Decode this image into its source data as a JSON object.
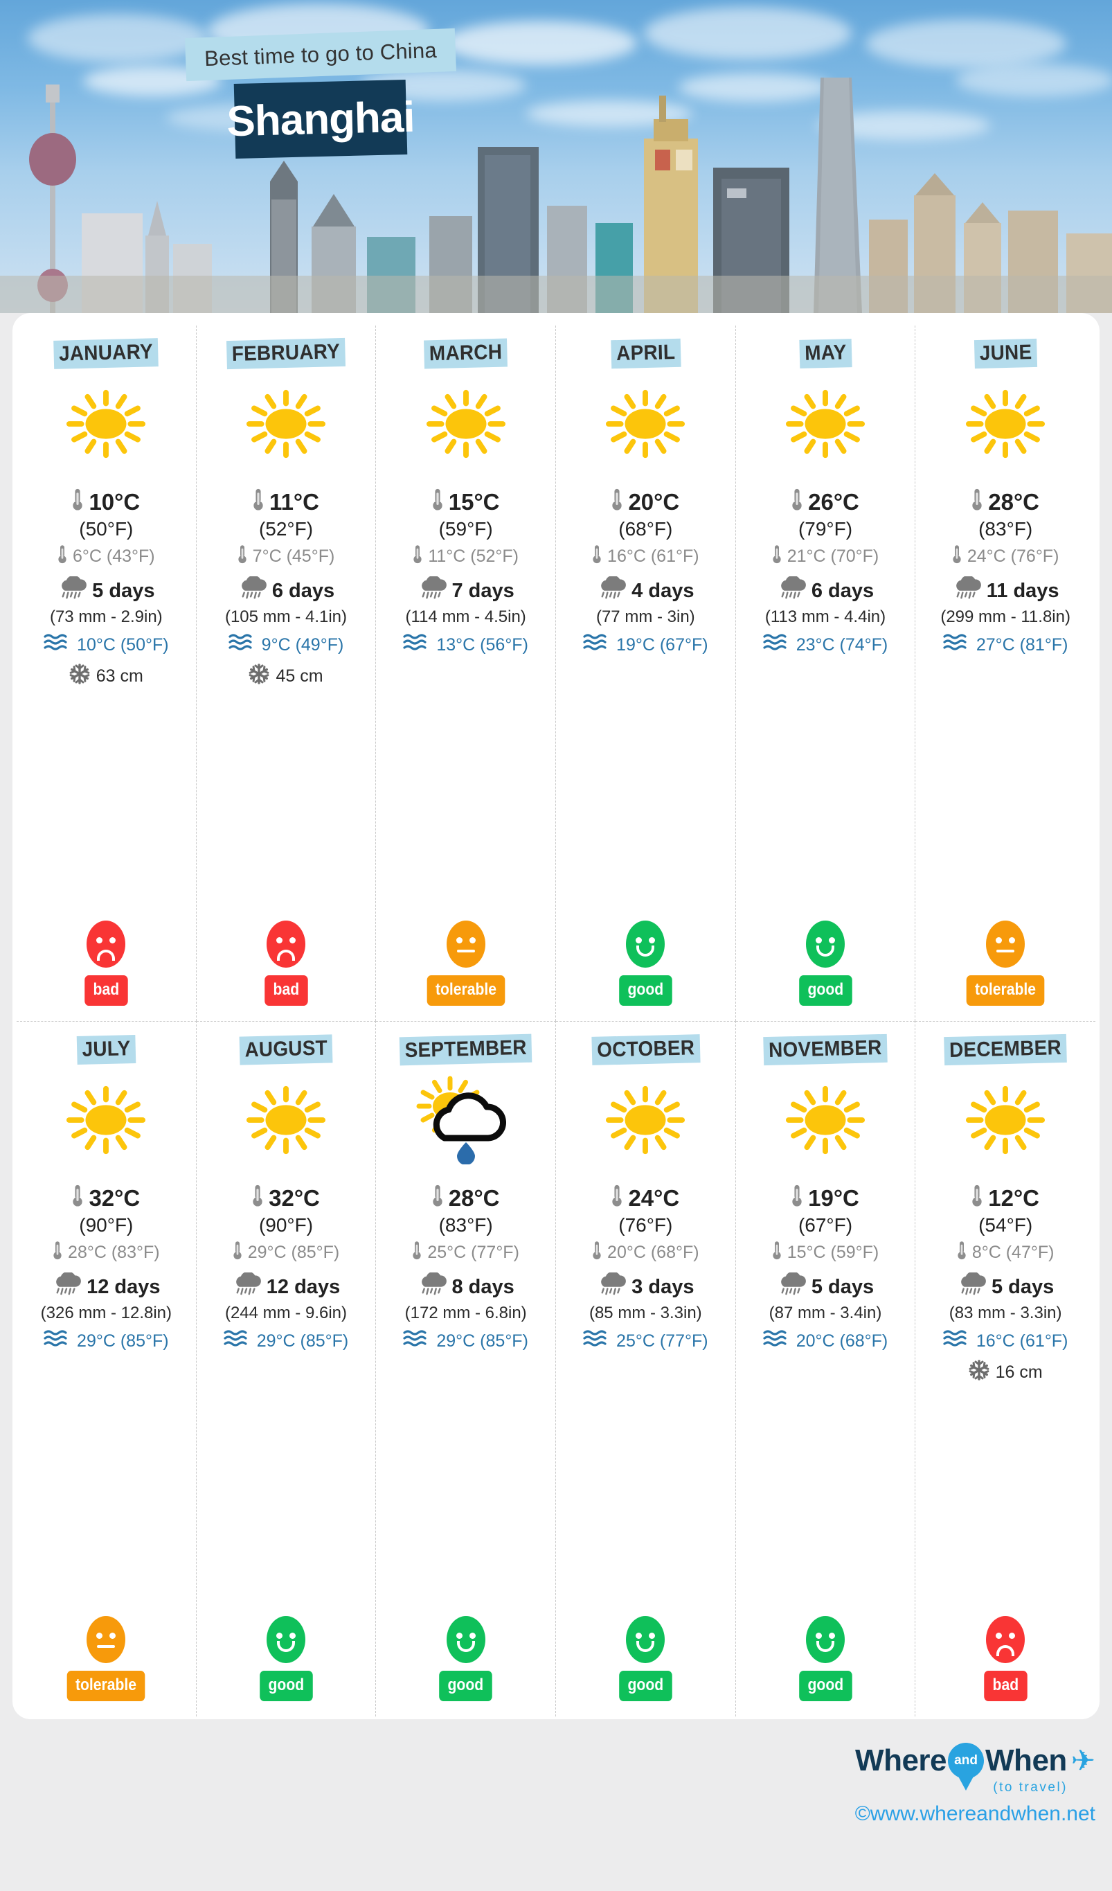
{
  "hero": {
    "subtitle": "Best time to go to China",
    "city": "Shanghai",
    "banner_color": "#b4dcec",
    "city_banner_color": "#123a56"
  },
  "footer": {
    "logo_word1": "Where",
    "logo_pin": "and",
    "logo_word2": "When",
    "logo_tagline": "(to travel)",
    "website": "©www.whereandwhen.net",
    "plane_icon": "airplane-icon",
    "accent_color": "#29a3e0",
    "dark_color": "#123a56"
  },
  "legend": {
    "icons": {
      "thermometer": "thermometer-icon",
      "rain_cloud": "rain-cloud-icon",
      "waves": "sea-temperature-icon",
      "snowflake": "snowflake-icon",
      "sun": "sun-icon",
      "sun_cloud_rain": "sun-cloud-rain-icon"
    },
    "verdict_colors": {
      "good": "#0fc05a",
      "tolerable": "#f79a0b",
      "bad": "#f93535"
    }
  },
  "months": [
    {
      "name": "JANUARY",
      "sky": "sun",
      "temp_max_c": "10°C",
      "temp_max_f": "(50°F)",
      "temp_min": "6°C (43°F)",
      "rain_days": "5 days",
      "rain_amount": "(73 mm - 2.9in)",
      "sea_temp": "10°C (50°F)",
      "snow": "63 cm",
      "verdict": "bad",
      "face": "frown"
    },
    {
      "name": "FEBRUARY",
      "sky": "sun",
      "temp_max_c": "11°C",
      "temp_max_f": "(52°F)",
      "temp_min": "7°C (45°F)",
      "rain_days": "6 days",
      "rain_amount": "(105 mm - 4.1in)",
      "sea_temp": "9°C (49°F)",
      "snow": "45 cm",
      "verdict": "bad",
      "face": "frown"
    },
    {
      "name": "MARCH",
      "sky": "sun",
      "temp_max_c": "15°C",
      "temp_max_f": "(59°F)",
      "temp_min": "11°C (52°F)",
      "rain_days": "7 days",
      "rain_amount": "(114 mm - 4.5in)",
      "sea_temp": "13°C (56°F)",
      "snow": "",
      "verdict": "tolerable",
      "face": "flat"
    },
    {
      "name": "APRIL",
      "sky": "sun",
      "temp_max_c": "20°C",
      "temp_max_f": "(68°F)",
      "temp_min": "16°C (61°F)",
      "rain_days": "4 days",
      "rain_amount": "(77 mm - 3in)",
      "sea_temp": "19°C (67°F)",
      "snow": "",
      "verdict": "good",
      "face": "smile"
    },
    {
      "name": "MAY",
      "sky": "sun",
      "temp_max_c": "26°C",
      "temp_max_f": "(79°F)",
      "temp_min": "21°C (70°F)",
      "rain_days": "6 days",
      "rain_amount": "(113 mm - 4.4in)",
      "sea_temp": "23°C (74°F)",
      "snow": "",
      "verdict": "good",
      "face": "smile"
    },
    {
      "name": "JUNE",
      "sky": "sun",
      "temp_max_c": "28°C",
      "temp_max_f": "(83°F)",
      "temp_min": "24°C (76°F)",
      "rain_days": "11 days",
      "rain_amount": "(299 mm - 11.8in)",
      "sea_temp": "27°C (81°F)",
      "snow": "",
      "verdict": "tolerable",
      "face": "flat"
    },
    {
      "name": "JULY",
      "sky": "sun",
      "temp_max_c": "32°C",
      "temp_max_f": "(90°F)",
      "temp_min": "28°C (83°F)",
      "rain_days": "12 days",
      "rain_amount": "(326 mm - 12.8in)",
      "sea_temp": "29°C (85°F)",
      "snow": "",
      "verdict": "tolerable",
      "face": "flat"
    },
    {
      "name": "AUGUST",
      "sky": "sun",
      "temp_max_c": "32°C",
      "temp_max_f": "(90°F)",
      "temp_min": "29°C (85°F)",
      "rain_days": "12 days",
      "rain_amount": "(244 mm - 9.6in)",
      "sea_temp": "29°C (85°F)",
      "snow": "",
      "verdict": "good",
      "face": "smile"
    },
    {
      "name": "SEPTEMBER",
      "sky": "sun_cloud_rain",
      "temp_max_c": "28°C",
      "temp_max_f": "(83°F)",
      "temp_min": "25°C (77°F)",
      "rain_days": "8 days",
      "rain_amount": "(172 mm - 6.8in)",
      "sea_temp": "29°C (85°F)",
      "snow": "",
      "verdict": "good",
      "face": "smile"
    },
    {
      "name": "OCTOBER",
      "sky": "sun",
      "temp_max_c": "24°C",
      "temp_max_f": "(76°F)",
      "temp_min": "20°C (68°F)",
      "rain_days": "3 days",
      "rain_amount": "(85 mm - 3.3in)",
      "sea_temp": "25°C (77°F)",
      "snow": "",
      "verdict": "good",
      "face": "smile"
    },
    {
      "name": "NOVEMBER",
      "sky": "sun",
      "temp_max_c": "19°C",
      "temp_max_f": "(67°F)",
      "temp_min": "15°C (59°F)",
      "rain_days": "5 days",
      "rain_amount": "(87 mm - 3.4in)",
      "sea_temp": "20°C (68°F)",
      "snow": "",
      "verdict": "good",
      "face": "smile"
    },
    {
      "name": "DECEMBER",
      "sky": "sun",
      "temp_max_c": "12°C",
      "temp_max_f": "(54°F)",
      "temp_min": "8°C (47°F)",
      "rain_days": "5 days",
      "rain_amount": "(83 mm - 3.3in)",
      "sea_temp": "16°C (61°F)",
      "snow": "16 cm",
      "verdict": "bad",
      "face": "frown"
    }
  ]
}
